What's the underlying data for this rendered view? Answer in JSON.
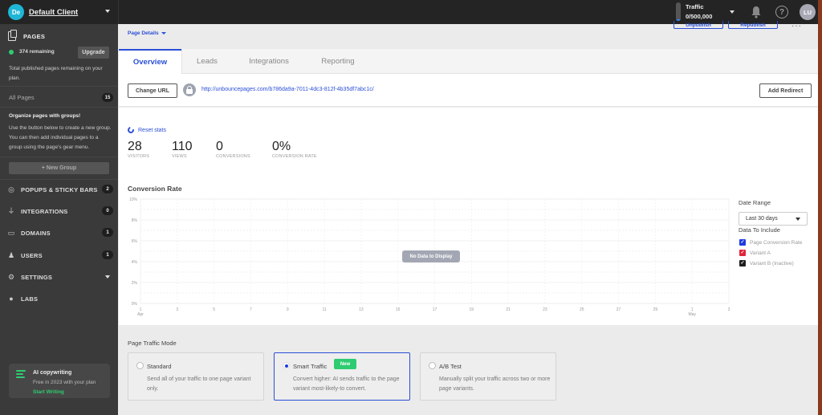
{
  "topbar": {
    "client_initials": "De",
    "client_name": "Default Client",
    "traffic_label": "Traffic",
    "traffic_value": "0/500,000",
    "traffic_fill_fraction": 0.1,
    "help_glyph": "?",
    "user_initials": "LU",
    "icons": {
      "bell": "bell-icon",
      "help": "help-icon"
    }
  },
  "sidebar": {
    "pages_title": "PAGES",
    "remaining": "374 remaining",
    "upgrade_label": "Upgrade",
    "remaining_note": "Total published pages remaining on your plan.",
    "all_pages_label": "All Pages",
    "all_pages_count": "15",
    "groups_title": "Organize pages with groups!",
    "groups_text": "Use the button below to create a new group. You can then add individual pages to a group using the page's gear menu.",
    "new_group_label": "+ New Group",
    "nav": [
      {
        "label": "POPUPS & STICKY BARS",
        "count": "2",
        "icon": "target-icon",
        "glyph": "◎"
      },
      {
        "label": "INTEGRATIONS",
        "count": "0",
        "icon": "plug-icon",
        "glyph": "⏚"
      },
      {
        "label": "DOMAINS",
        "count": "1",
        "icon": "domain-icon",
        "glyph": "▭"
      },
      {
        "label": "USERS",
        "count": "1",
        "icon": "users-icon",
        "glyph": "♟"
      },
      {
        "label": "SETTINGS",
        "count": null,
        "icon": "gear-icon",
        "glyph": "⚙"
      },
      {
        "label": "LABS",
        "count": null,
        "icon": "flask-icon",
        "glyph": "●"
      }
    ],
    "ai_card": {
      "title": "AI copywriting",
      "subtitle": "Free in 2023 with your plan",
      "link": "Start Writing"
    }
  },
  "main": {
    "page_details_label": "Page Details",
    "header_buttons": [
      "Unpublish",
      "Republish"
    ],
    "more_glyph": "···",
    "tabs": [
      {
        "label": "Overview",
        "active": true
      },
      {
        "label": "Leads",
        "active": false
      },
      {
        "label": "Integrations",
        "active": false
      },
      {
        "label": "Reporting",
        "active": false
      }
    ],
    "change_url_label": "Change URL",
    "url": "http://unbouncepages.com/b786da9a-7011-4dc3-812f-4b35df7abc1c/",
    "add_redirect_label": "Add Redirect",
    "reset_stats_label": "Reset stats",
    "stats": [
      {
        "value": "28",
        "label": "VISITORS"
      },
      {
        "value": "110",
        "label": "VIEWS"
      },
      {
        "value": "0",
        "label": "CONVERSIONS"
      },
      {
        "value": "0%",
        "label": "CONVERSION RATE"
      }
    ],
    "chart_title": "Conversion Rate",
    "no_data_label": "No Data to Display",
    "date_range_label": "Date Range",
    "date_range_value": "Last 30 days",
    "data_to_include_label": "Data To Include",
    "legend": [
      {
        "label": "Page Conversion Rate",
        "color": "#1d3be0",
        "checked": true
      },
      {
        "label": "Variant A",
        "color": "#e0243a",
        "checked": true
      },
      {
        "label": "Variant B (Inactive)",
        "color": "#1e1e1e",
        "checked": true
      }
    ],
    "traffic_mode": {
      "title": "Page Traffic Mode",
      "options": [
        {
          "name": "Standard",
          "desc": "Send all of your traffic to one page variant only.",
          "selected": false,
          "badge": null
        },
        {
          "name": "Smart Traffic",
          "desc": "Convert higher: AI sends traffic to the page variant most-likely-to convert.",
          "selected": true,
          "badge": "New"
        },
        {
          "name": "A/B Test",
          "desc": "Manually split your traffic across two or more page variants.",
          "selected": false,
          "badge": null
        }
      ]
    }
  },
  "chart_data": {
    "type": "line",
    "title": "Conversion Rate",
    "xlabel": "",
    "ylabel": "",
    "ylim": [
      0,
      10
    ],
    "y_ticks": [
      "0%",
      "2%",
      "4%",
      "6%",
      "8%",
      "10%"
    ],
    "x_ticks": [
      {
        "label": "1",
        "sub": "Apr"
      },
      {
        "label": "3",
        "sub": ""
      },
      {
        "label": "5",
        "sub": ""
      },
      {
        "label": "7",
        "sub": ""
      },
      {
        "label": "9",
        "sub": ""
      },
      {
        "label": "11",
        "sub": ""
      },
      {
        "label": "13",
        "sub": ""
      },
      {
        "label": "15",
        "sub": ""
      },
      {
        "label": "17",
        "sub": ""
      },
      {
        "label": "19",
        "sub": ""
      },
      {
        "label": "21",
        "sub": ""
      },
      {
        "label": "23",
        "sub": ""
      },
      {
        "label": "25",
        "sub": ""
      },
      {
        "label": "27",
        "sub": ""
      },
      {
        "label": "29",
        "sub": ""
      },
      {
        "label": "1",
        "sub": "May"
      },
      {
        "label": "3",
        "sub": ""
      }
    ],
    "series": [],
    "grid": true,
    "annotation": "No Data to Display"
  }
}
